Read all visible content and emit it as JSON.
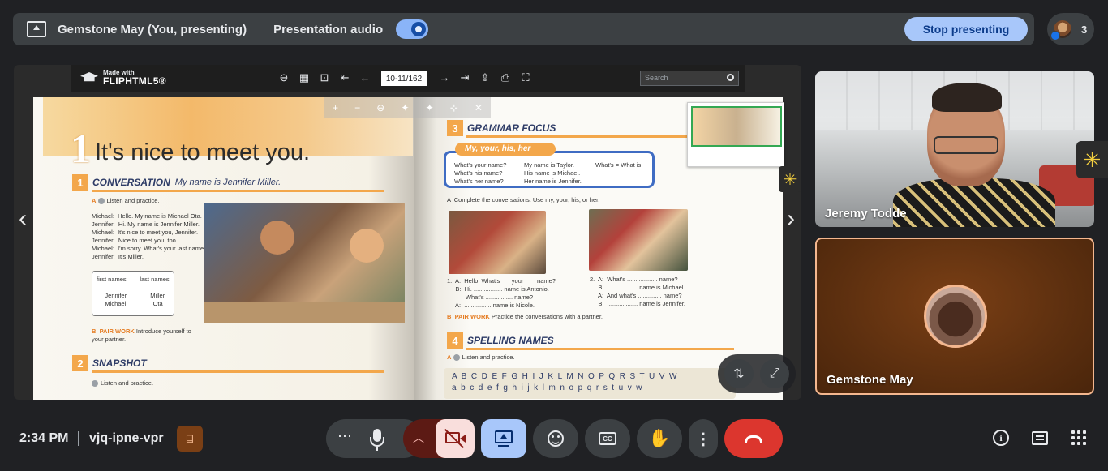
{
  "top_bar": {
    "presenter_label": "Gemstone May (You, presenting)",
    "audio_label": "Presentation audio",
    "audio_enabled": true,
    "stop_label": "Stop presenting",
    "participant_count": "3",
    "accent_color": "#a8c7fa"
  },
  "flip_viewer": {
    "logo_small": "Made with",
    "logo_big": "FLIPHTML5®",
    "page_indicator": "10-11/162",
    "search_placeholder": "Search",
    "zoom_tools": [
      "+",
      "−",
      "⊖",
      "✦",
      "✦",
      "⊹",
      "✕"
    ]
  },
  "book": {
    "left": {
      "unit_number": "1",
      "title": "It's nice to meet you.",
      "section1_num": "1",
      "section1_title": "CONVERSATION",
      "section1_sub": "My name is Jennifer Miller.",
      "section1_a": "A",
      "section1_a_text": "Listen and practice.",
      "dialogue": "Michael:  Hello. My name is Michael Ota.\nJennifer:  Hi. My name is Jennifer Miller.\nMichael:  It's nice to meet you, Jennifer.\nJennifer:  Nice to meet you, too.\nMichael:  I'm sorry. What's your last name again?\nJennifer:  It's Miller.",
      "names_box": "first names        last names\n\n     Jennifer              Miller\n     Michael                Ota",
      "pair_label": "B  PAIR WORK",
      "pair_text": " Introduce yourself to\nyour partner.",
      "section2_num": "2",
      "section2_title": "SNAPSHOT",
      "section2_text": "Listen and practice."
    },
    "right": {
      "section3_num": "3",
      "section3_title": "GRAMMAR FOCUS",
      "grammar_tab": "My, your, his, her",
      "grammar_col1": "What's your name?\nWhat's his name?\nWhat's her name?",
      "grammar_col2": "My name is Taylor.\nHis name is Michael.\nHer name is Jennifer.",
      "grammar_col3": "What's = What is",
      "exercise_a": "A  Complete the conversations. Use my, your, his, or her.",
      "conv1": "1.  A:  Hello. What's       your        name?\n     B:  Hi. ................. name is Antonio.\n           What's ................ name?\n     A:  ................ name is Nicole.",
      "conv2": "2.  A:  What's .................. name?\n     B:  .................. name is Michael.\n     A:  And what's .............. name?\n     B:  .................. name is Jennifer.",
      "pair_label": "B  PAIR WORK",
      "pair_text": " Practice the conversations with a partner.",
      "section4_num": "4",
      "section4_title": "SPELLING NAMES",
      "section4_a": "A",
      "section4_a_text": "Listen and practice.",
      "alphabet_upper": "A  B  C  D  E  F  G  H  I  J  K  L  M  N  O  P  Q  R  S  T  U  V  W",
      "alphabet_lower": "a  b  c  d  e  f  g  h  i  j  k  l  m  n  o  p  q  r  s  t  u  v  w"
    }
  },
  "tiles": {
    "jeremy_name": "Jeremy Todde",
    "gemstone_name": "Gemstone May",
    "gemstone_border": "#f4b78f"
  },
  "bottom_bar": {
    "time": "2:34 PM",
    "meeting_code": "vjq-ipne-vpr",
    "hangup_color": "#dc362e"
  }
}
